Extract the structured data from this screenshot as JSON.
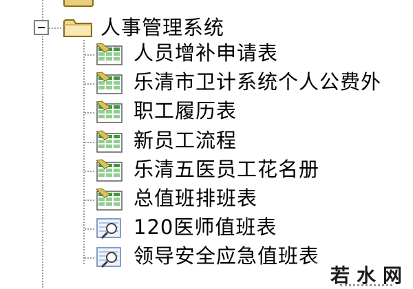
{
  "tree": {
    "root": {
      "label": "人事管理系统",
      "expanded": true,
      "icon": "folder-icon"
    },
    "children": [
      {
        "label": "人员增补申请表",
        "icon": "report-icon"
      },
      {
        "label": "乐清市卫计系统个人公费外",
        "icon": "report-icon"
      },
      {
        "label": "职工履历表",
        "icon": "report-icon"
      },
      {
        "label": "新员工流程",
        "icon": "report-icon"
      },
      {
        "label": "乐清五医员工花名册",
        "icon": "report-icon"
      },
      {
        "label": "总值班排班表",
        "icon": "report-icon"
      },
      {
        "label": "120医师值班表",
        "icon": "query-icon"
      },
      {
        "label": "领导安全应急值班表",
        "icon": "query-icon"
      }
    ]
  },
  "watermark": {
    "text": "若水网"
  },
  "colors": {
    "guide_line": "#9a9a9a",
    "folder_fill": "#f2d98a",
    "folder_stroke": "#8a6a1c",
    "report_green": "#3f9a3f",
    "report_yellow": "#d8c25a",
    "query_blue": "#5b7fb0"
  }
}
